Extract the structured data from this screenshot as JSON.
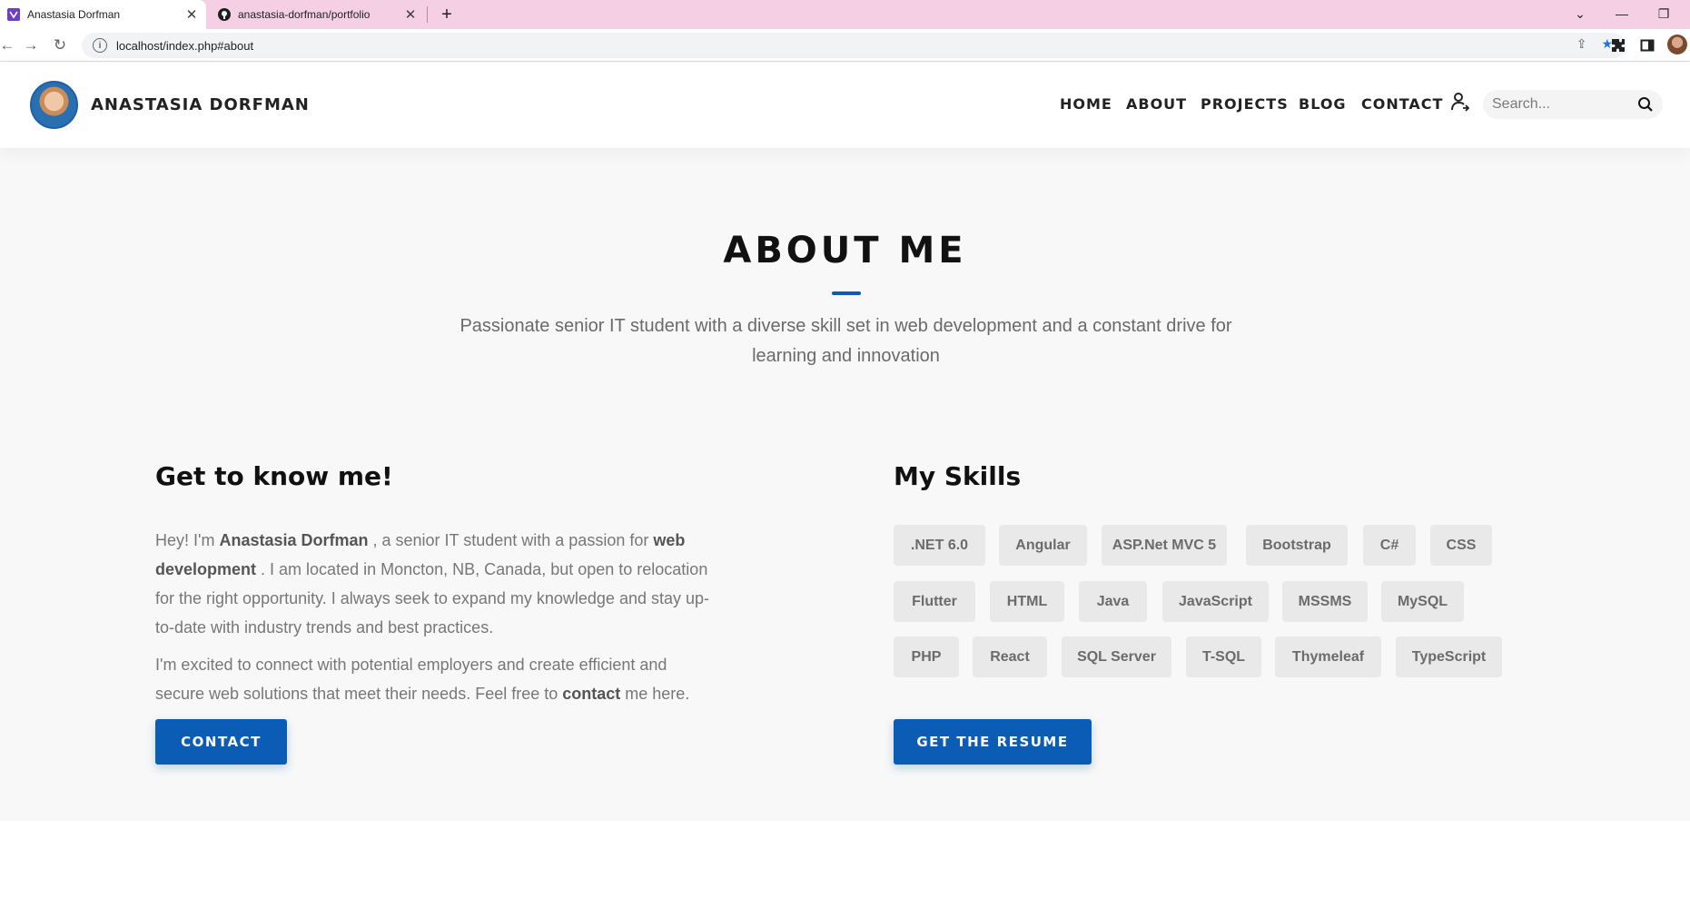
{
  "browser": {
    "tabs": [
      {
        "title": "Anastasia Dorfman",
        "close": "✕"
      },
      {
        "title": "anastasia-dorfman/portfolio",
        "close": "✕"
      }
    ],
    "new_tab": "+",
    "url": "localhost/index.php#about"
  },
  "site": {
    "brand": "ANASTASIA DORFMAN",
    "nav": [
      "HOME",
      "ABOUT",
      "PROJECTS",
      "BLOG",
      "CONTACT"
    ],
    "search_placeholder": "Search..."
  },
  "about": {
    "title": "ABOUT ME",
    "subtitle": "Passionate senior IT student with a diverse skill set in web development and a constant drive for learning and innovation",
    "left": {
      "heading": "Get to know me!",
      "para1": {
        "t1": "Hey! I'm ",
        "b1": "Anastasia Dorfman",
        "t2": " , a senior IT student with a passion for ",
        "b2": "web development",
        "t3": " . I am located in Moncton, NB, Canada, but open to relocation for the right opportunity. I always seek to expand my knowledge and stay up-to-date with industry trends and best practices."
      },
      "para2": {
        "t1": "I'm excited to connect with potential employers and create efficient and secure web solutions that meet their needs. Feel free to ",
        "b1": "contact",
        "t2": " me here."
      },
      "button": "CONTACT"
    },
    "right": {
      "heading": "My Skills",
      "skills": [
        ".NET 6.0",
        "Angular",
        "ASP.Net MVC 5",
        "Bootstrap",
        "C#",
        "CSS",
        "Flutter",
        "HTML",
        "Java",
        "JavaScript",
        "MSSMS",
        "MySQL",
        "PHP",
        "React",
        "SQL Server",
        "T-SQL",
        "Thymeleaf",
        "TypeScript"
      ],
      "button": "GET THE RESUME"
    }
  },
  "colors": {
    "accent": "#0a5cb5",
    "tabbar": "#f5d0e4",
    "section_bg": "#f8f8f8",
    "skill_bg": "#e9e9e9"
  }
}
